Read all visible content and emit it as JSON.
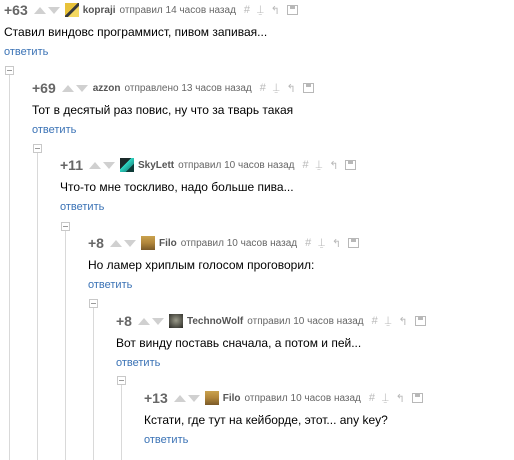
{
  "comments": [
    {
      "score": "+63",
      "user": "kopraji",
      "meta": "отправил 14 часов назад",
      "text": "Ставил виндовс программист, пивом запивая...",
      "reply": "ответить",
      "avatar": "kopraji-avatar"
    },
    {
      "score": "+69",
      "user": "azzon",
      "meta": "отправлено 13 часов назад",
      "text": "Тот в десятый раз повис, ну что за тварь такая",
      "reply": "ответить",
      "avatar": "none"
    },
    {
      "score": "+11",
      "user": "SkyLett",
      "meta": "отправил 10 часов назад",
      "text": "Что-то мне тоскливо, надо больше пива...",
      "reply": "ответить",
      "avatar": "skylett-avatar"
    },
    {
      "score": "+8",
      "user": "Filo",
      "meta": "отправил 10 часов назад",
      "text": "Но ламер хриплым голосом проговорил:",
      "reply": "ответить",
      "avatar": "filo-avatar"
    },
    {
      "score": "+8",
      "user": "TechnoWolf",
      "meta": "отправил 10 часов назад",
      "text": "Вот винду поставь сначала, а потом и пей...",
      "reply": "ответить",
      "avatar": "technowolf-avatar"
    },
    {
      "score": "+13",
      "user": "Filo",
      "meta": "отправил 10 часов назад",
      "text": "Кстати, где тут на кейборде, этот... any key?",
      "reply": "ответить",
      "avatar": "filo-avatar"
    }
  ],
  "tool_icons": [
    "hash-icon",
    "link-icon",
    "reply-link-icon",
    "save-icon"
  ],
  "colors": {
    "reply_link": "#3a72b5",
    "score": "#666666",
    "vote_arrow": "#d0d0d0",
    "thread_line": "#d9d9d9"
  }
}
